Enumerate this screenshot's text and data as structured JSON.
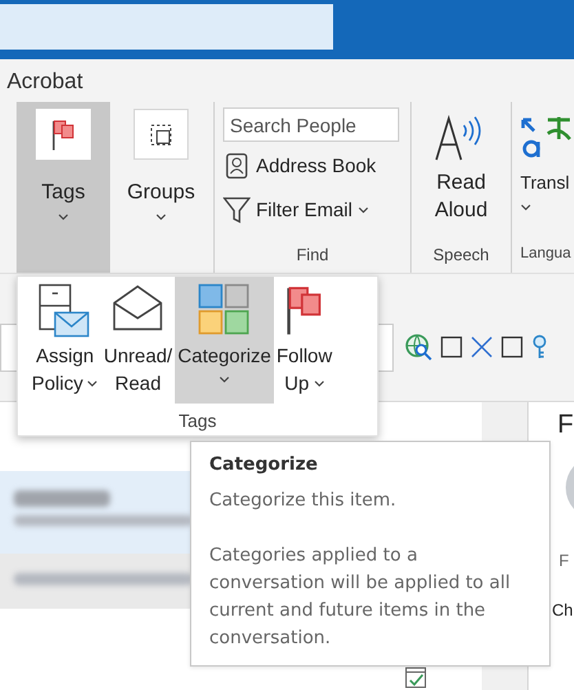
{
  "ribbon": {
    "tab": "Acrobat",
    "groups": [
      {
        "kind": "large",
        "buttons": [
          {
            "label": "Tags",
            "selected": true,
            "has_menu": true
          },
          {
            "label": "Groups",
            "selected": false,
            "has_menu": true
          }
        ]
      },
      {
        "kind": "find",
        "label": "Find",
        "search": {
          "placeholder": "Search People"
        },
        "buttons": [
          {
            "label": "Address Book",
            "has_menu": false
          },
          {
            "label": "Filter Email",
            "has_menu": true
          }
        ]
      },
      {
        "kind": "large",
        "label": "Speech",
        "buttons": [
          {
            "label": "Read Aloud",
            "selected": false,
            "has_menu": false
          }
        ]
      },
      {
        "kind": "large",
        "label": "Langua",
        "buttons": [
          {
            "label": "Transl",
            "selected": false,
            "has_menu": true
          }
        ]
      }
    ]
  },
  "tags_menu": {
    "label": "Tags",
    "buttons": [
      {
        "lines": [
          "Assign",
          "Policy"
        ],
        "has_menu": true,
        "selected": false
      },
      {
        "lines": [
          "Unread/",
          "Read"
        ],
        "has_menu": false,
        "selected": false
      },
      {
        "lines": [
          "Categorize"
        ],
        "has_menu": true,
        "selected": true
      },
      {
        "lines": [
          "Follow",
          "Up"
        ],
        "has_menu": true,
        "selected": false
      }
    ]
  },
  "tooltip": {
    "title": "Categorize",
    "paragraphs": [
      "Categorize this item.",
      "Categories applied to a conversation will be applied to all current and future items in the conversation."
    ]
  },
  "reading_pane": {
    "heading": "F",
    "sender_line": "F",
    "footer": "Ch"
  }
}
